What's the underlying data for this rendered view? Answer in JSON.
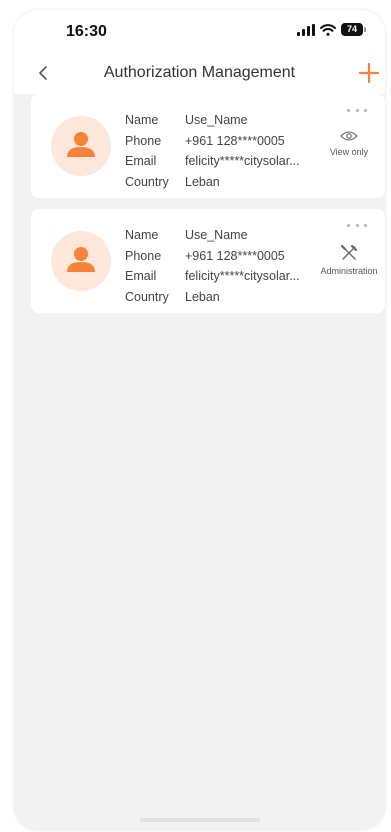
{
  "status_bar": {
    "time": "16:30",
    "battery": "74",
    "icons": [
      "signal-icon",
      "wifi-icon",
      "battery-icon"
    ]
  },
  "nav": {
    "title": "Authorization Management",
    "back_icon": "chevron-left-icon",
    "add_icon": "plus-icon"
  },
  "colors": {
    "accent": "#f5843a",
    "avatar_bg": "#fde6da",
    "page_bg": "#f2f2f2",
    "card_bg": "#ffffff"
  },
  "fields": {
    "name": "Name",
    "phone": "Phone",
    "email": "Email",
    "country": "Country"
  },
  "users": [
    {
      "name": "Use_Name",
      "phone": "+961 128****0005",
      "email": "felicity*****citysolar...",
      "country": "Leban",
      "role": "View only",
      "role_icon": "eye-icon"
    },
    {
      "name": "Use_Name",
      "phone": "+961 128****0005",
      "email": "felicity*****citysolar...",
      "country": "Leban",
      "role": "Administration",
      "role_icon": "tools-icon"
    }
  ]
}
